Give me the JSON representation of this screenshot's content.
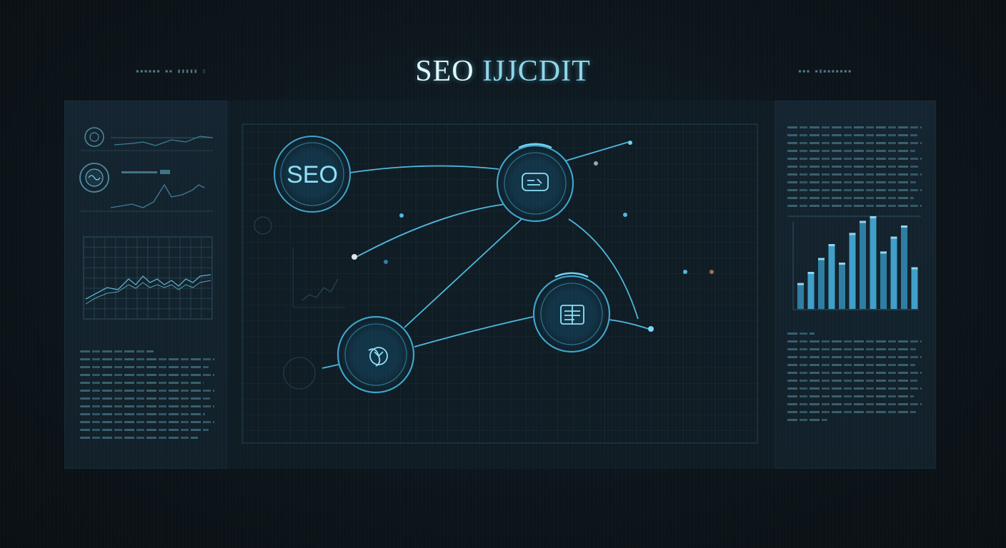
{
  "header": {
    "title_part1": "SEO ",
    "title_part2": "IJJCDIT"
  },
  "nodes": {
    "seo_label": "SEO"
  },
  "colors": {
    "background": "#0b1115",
    "panel": "#142430",
    "accent": "#4fb8dd",
    "accent_glow": "#6fd3f2",
    "node_fill": "#0f2634"
  },
  "icons": {
    "node_top_right": "chat-dashboard-icon",
    "node_bottom_left": "globe-chart-icon",
    "node_right": "report-icon",
    "left_top": "target-icon",
    "left_mid": "brain-icon",
    "center_small": "ribbon-icon"
  },
  "right_panel_chart": {
    "type": "bar",
    "values": [
      0.28,
      0.4,
      0.55,
      0.7,
      0.5,
      0.82,
      0.95,
      1.0,
      0.62,
      0.78,
      0.9,
      0.45
    ]
  }
}
